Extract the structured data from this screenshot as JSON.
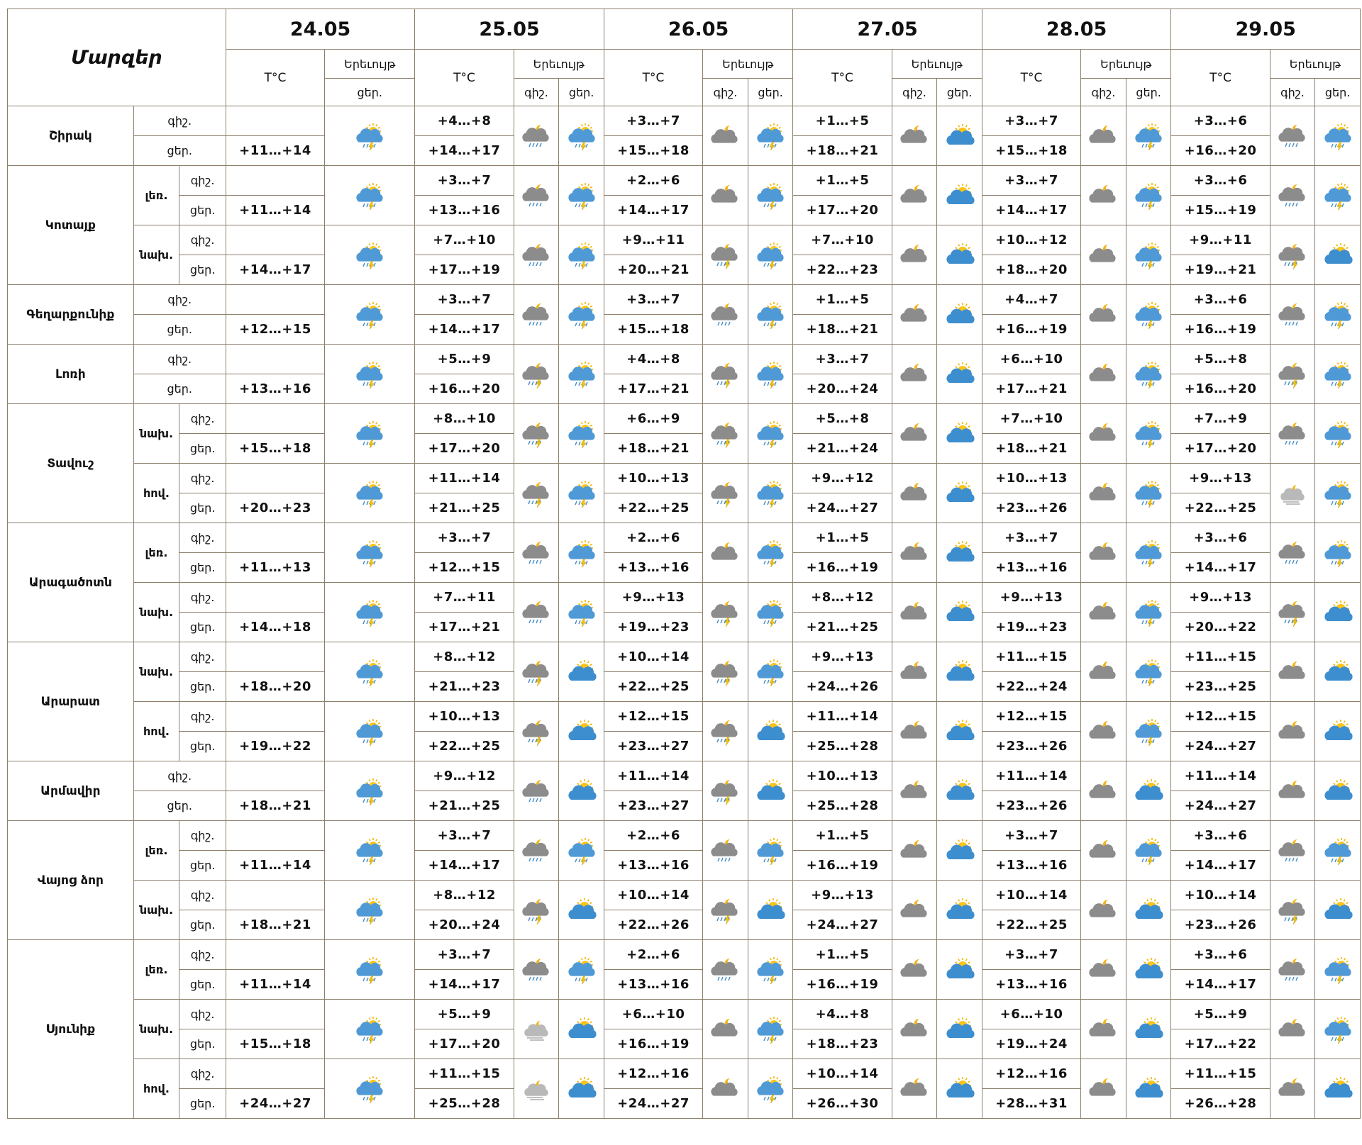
{
  "header": {
    "title": "Մարզեր",
    "dates": [
      "24.05",
      "25.05",
      "26.05",
      "27.05",
      "28.05",
      "29.05"
    ],
    "temp_label": "T°C",
    "phenomenon_label": "Երեւույթ",
    "night_label": "գիշ.",
    "day_label": "ցեր."
  },
  "regions": [
    {
      "name": "Շիրակ",
      "zones": [
        {
          "zone": "",
          "night": [
            "",
            "+4…+8",
            "+3…+7",
            "+1…+5",
            "+3…+7",
            "+3…+6"
          ],
          "day": [
            "+11…+14",
            "+14…+17",
            "+15…+18",
            "+18…+21",
            "+15…+18",
            "+16…+20"
          ],
          "icons_night": [
            "",
            "cloud-moon-rain",
            "cloud-moon",
            "cloud-moon",
            "cloud-moon",
            "cloud-moon-rain"
          ],
          "icons_day": [
            "sun-cloud-rain",
            "sun-cloud-rain",
            "sun-cloud-rain",
            "sun-cloud",
            "sun-cloud-rain",
            "sun-cloud-rain"
          ]
        }
      ]
    },
    {
      "name": "Կոտայք",
      "zones": [
        {
          "zone": "լեռ.",
          "night": [
            "",
            "+3…+7",
            "+2…+6",
            "+1…+5",
            "+3…+7",
            "+3…+6"
          ],
          "day": [
            "+11…+14",
            "+13…+16",
            "+14…+17",
            "+17…+20",
            "+14…+17",
            "+15…+19"
          ],
          "icons_night": [
            "",
            "cloud-moon-rain",
            "cloud-moon",
            "cloud-moon",
            "cloud-moon",
            "cloud-moon-rain"
          ],
          "icons_day": [
            "sun-cloud-rain",
            "sun-cloud-rain",
            "sun-cloud-rain",
            "sun-cloud",
            "sun-cloud-rain",
            "sun-cloud-rain"
          ]
        },
        {
          "zone": "նախ.",
          "night": [
            "",
            "+7…+10",
            "+9…+11",
            "+7…+10",
            "+10…+12",
            "+9…+11"
          ],
          "day": [
            "+14…+17",
            "+17…+19",
            "+20…+21",
            "+22…+23",
            "+18…+20",
            "+19…+21"
          ],
          "icons_night": [
            "",
            "cloud-moon-rain",
            "cloud-moon-storm",
            "cloud-moon",
            "cloud-moon",
            "cloud-moon-storm"
          ],
          "icons_day": [
            "sun-cloud-rain",
            "sun-cloud-rain",
            "sun-cloud-rain",
            "sun-cloud",
            "sun-cloud-rain",
            "sun-cloud"
          ]
        }
      ]
    },
    {
      "name": "Գեղարքունիք",
      "zones": [
        {
          "zone": "",
          "night": [
            "",
            "+3…+7",
            "+3…+7",
            "+1…+5",
            "+4…+7",
            "+3…+6"
          ],
          "day": [
            "+12…+15",
            "+14…+17",
            "+15…+18",
            "+18…+21",
            "+16…+19",
            "+16…+19"
          ],
          "icons_night": [
            "",
            "cloud-moon-rain",
            "cloud-moon-rain",
            "cloud-moon",
            "cloud-moon",
            "cloud-moon-rain"
          ],
          "icons_day": [
            "sun-cloud-rain",
            "sun-cloud-rain",
            "sun-cloud-rain",
            "sun-cloud",
            "sun-cloud-rain",
            "sun-cloud-rain"
          ]
        }
      ]
    },
    {
      "name": "Լոռի",
      "zones": [
        {
          "zone": "",
          "night": [
            "",
            "+5…+9",
            "+4…+8",
            "+3…+7",
            "+6…+10",
            "+5…+8"
          ],
          "day": [
            "+13…+16",
            "+16…+20",
            "+17…+21",
            "+20…+24",
            "+17…+21",
            "+16…+20"
          ],
          "icons_night": [
            "",
            "cloud-moon-storm",
            "cloud-moon-storm",
            "cloud-moon",
            "cloud-moon",
            "cloud-moon-storm"
          ],
          "icons_day": [
            "sun-cloud-rain",
            "sun-cloud-rain",
            "sun-cloud-rain",
            "sun-cloud",
            "sun-cloud-rain",
            "sun-cloud-rain"
          ]
        }
      ]
    },
    {
      "name": "Տավուշ",
      "zones": [
        {
          "zone": "նախ.",
          "night": [
            "",
            "+8…+10",
            "+6…+9",
            "+5…+8",
            "+7…+10",
            "+7…+9"
          ],
          "day": [
            "+15…+18",
            "+17…+20",
            "+18…+21",
            "+21…+24",
            "+18…+21",
            "+17…+20"
          ],
          "icons_night": [
            "",
            "cloud-moon-storm",
            "cloud-moon-storm",
            "cloud-moon",
            "cloud-moon",
            "cloud-moon-rain"
          ],
          "icons_day": [
            "sun-cloud-rain",
            "sun-cloud-rain",
            "sun-cloud-rain",
            "sun-cloud",
            "sun-cloud-rain",
            "sun-cloud-rain"
          ]
        },
        {
          "zone": "հով.",
          "night": [
            "",
            "+11…+14",
            "+10…+13",
            "+9…+12",
            "+10…+13",
            "+9…+13"
          ],
          "day": [
            "+20…+23",
            "+21…+25",
            "+22…+25",
            "+24…+27",
            "+23…+26",
            "+22…+25"
          ],
          "icons_night": [
            "",
            "cloud-moon-storm",
            "cloud-moon-storm",
            "cloud-moon",
            "cloud-moon",
            "cloud-fog"
          ],
          "icons_day": [
            "sun-cloud-rain",
            "sun-cloud-rain",
            "sun-cloud-rain",
            "sun-cloud",
            "sun-cloud-rain",
            "sun-cloud-rain"
          ]
        }
      ]
    },
    {
      "name": "Արագածոտն",
      "zones": [
        {
          "zone": "լեռ.",
          "night": [
            "",
            "+3…+7",
            "+2…+6",
            "+1…+5",
            "+3…+7",
            "+3…+6"
          ],
          "day": [
            "+11…+13",
            "+12…+15",
            "+13…+16",
            "+16…+19",
            "+13…+16",
            "+14…+17"
          ],
          "icons_night": [
            "",
            "cloud-moon-rain",
            "cloud-moon",
            "cloud-moon",
            "cloud-moon",
            "cloud-moon-rain"
          ],
          "icons_day": [
            "sun-cloud-rain",
            "sun-cloud-rain",
            "sun-cloud-rain",
            "sun-cloud",
            "sun-cloud-rain",
            "sun-cloud-rain"
          ]
        },
        {
          "zone": "նախ.",
          "night": [
            "",
            "+7…+11",
            "+9…+13",
            "+8…+12",
            "+9…+13",
            "+9…+13"
          ],
          "day": [
            "+14…+18",
            "+17…+21",
            "+19…+23",
            "+21…+25",
            "+19…+23",
            "+20…+22"
          ],
          "icons_night": [
            "",
            "cloud-moon-rain",
            "cloud-moon-storm",
            "cloud-moon",
            "cloud-moon",
            "cloud-moon-storm"
          ],
          "icons_day": [
            "sun-cloud-rain",
            "sun-cloud-rain",
            "sun-cloud-rain",
            "sun-cloud",
            "sun-cloud-rain",
            "sun-cloud"
          ]
        }
      ]
    },
    {
      "name": "Արարատ",
      "zones": [
        {
          "zone": "նախ.",
          "night": [
            "",
            "+8…+12",
            "+10…+14",
            "+9…+13",
            "+11…+15",
            "+11…+15"
          ],
          "day": [
            "+18…+20",
            "+21…+23",
            "+22…+25",
            "+24…+26",
            "+22…+24",
            "+23…+25"
          ],
          "icons_night": [
            "",
            "cloud-moon-storm",
            "cloud-moon-storm",
            "cloud-moon",
            "cloud-moon",
            "cloud-moon"
          ],
          "icons_day": [
            "sun-cloud-rain",
            "sun-cloud",
            "sun-cloud-rain",
            "sun-cloud",
            "sun-cloud-rain",
            "sun-cloud"
          ]
        },
        {
          "zone": "հով.",
          "night": [
            "",
            "+10…+13",
            "+12…+15",
            "+11…+14",
            "+12…+15",
            "+12…+15"
          ],
          "day": [
            "+19…+22",
            "+22…+25",
            "+23…+27",
            "+25…+28",
            "+23…+26",
            "+24…+27"
          ],
          "icons_night": [
            "",
            "cloud-moon-storm",
            "cloud-moon-storm",
            "cloud-moon",
            "cloud-moon",
            "cloud-moon"
          ],
          "icons_day": [
            "sun-cloud-rain",
            "sun-cloud",
            "sun-cloud",
            "sun-cloud",
            "sun-cloud-rain",
            "sun-cloud"
          ]
        }
      ]
    },
    {
      "name": "Արմավիր",
      "zones": [
        {
          "zone": "",
          "night": [
            "",
            "+9…+12",
            "+11…+14",
            "+10…+13",
            "+11…+14",
            "+11…+14"
          ],
          "day": [
            "+18…+21",
            "+21…+25",
            "+23…+27",
            "+25…+28",
            "+23…+26",
            "+24…+27"
          ],
          "icons_night": [
            "",
            "cloud-moon-rain",
            "cloud-moon-storm",
            "cloud-moon",
            "cloud-moon",
            "cloud-moon"
          ],
          "icons_day": [
            "sun-cloud-rain",
            "sun-cloud",
            "sun-cloud",
            "sun-cloud",
            "sun-cloud",
            "sun-cloud"
          ]
        }
      ]
    },
    {
      "name": "Վայոց ձոր",
      "zones": [
        {
          "zone": "լեռ.",
          "night": [
            "",
            "+3…+7",
            "+2…+6",
            "+1…+5",
            "+3…+7",
            "+3…+6"
          ],
          "day": [
            "+11…+14",
            "+14…+17",
            "+13…+16",
            "+16…+19",
            "+13…+16",
            "+14…+17"
          ],
          "icons_night": [
            "",
            "cloud-moon-rain",
            "cloud-moon-rain",
            "cloud-moon",
            "cloud-moon",
            "cloud-moon-rain"
          ],
          "icons_day": [
            "sun-cloud-rain",
            "sun-cloud-rain",
            "sun-cloud-rain",
            "sun-cloud",
            "sun-cloud-rain",
            "sun-cloud-rain"
          ]
        },
        {
          "zone": "նախ.",
          "night": [
            "",
            "+8…+12",
            "+10…+14",
            "+9…+13",
            "+10…+14",
            "+10…+14"
          ],
          "day": [
            "+18…+21",
            "+20…+24",
            "+22…+26",
            "+24…+27",
            "+22…+25",
            "+23…+26"
          ],
          "icons_night": [
            "",
            "cloud-moon-storm",
            "cloud-moon-storm",
            "cloud-moon",
            "cloud-moon",
            "cloud-moon-storm"
          ],
          "icons_day": [
            "sun-cloud-rain",
            "sun-cloud",
            "sun-cloud",
            "sun-cloud",
            "sun-cloud",
            "sun-cloud"
          ]
        }
      ]
    },
    {
      "name": "Սյունիք",
      "zones": [
        {
          "zone": "լեռ.",
          "night": [
            "",
            "+3…+7",
            "+2…+6",
            "+1…+5",
            "+3…+7",
            "+3…+6"
          ],
          "day": [
            "+11…+14",
            "+14…+17",
            "+13…+16",
            "+16…+19",
            "+13…+16",
            "+14…+17"
          ],
          "icons_night": [
            "",
            "cloud-moon-rain",
            "cloud-moon-rain",
            "cloud-moon",
            "cloud-moon",
            "cloud-moon-rain"
          ],
          "icons_day": [
            "sun-cloud-rain",
            "sun-cloud-rain",
            "sun-cloud-rain",
            "sun-cloud",
            "sun-cloud",
            "sun-cloud-rain"
          ]
        },
        {
          "zone": "նախ.",
          "night": [
            "",
            "+5…+9",
            "+6…+10",
            "+4…+8",
            "+6…+10",
            "+5…+9"
          ],
          "day": [
            "+15…+18",
            "+17…+20",
            "+16…+19",
            "+18…+23",
            "+19…+24",
            "+17…+22"
          ],
          "icons_night": [
            "",
            "cloud-fog",
            "cloud-moon",
            "cloud-moon",
            "cloud-moon",
            "cloud-moon"
          ],
          "icons_day": [
            "sun-cloud-rain",
            "sun-cloud",
            "sun-cloud-rain",
            "sun-cloud",
            "sun-cloud",
            "sun-cloud-rain"
          ]
        },
        {
          "zone": "հով.",
          "night": [
            "",
            "+11…+15",
            "+12…+16",
            "+10…+14",
            "+12…+16",
            "+11…+15"
          ],
          "day": [
            "+24…+27",
            "+25…+28",
            "+24…+27",
            "+26…+30",
            "+28…+31",
            "+26…+28"
          ],
          "icons_night": [
            "",
            "cloud-fog",
            "cloud-moon",
            "cloud-moon",
            "cloud-moon",
            "cloud-moon"
          ],
          "icons_day": [
            "sun-cloud-rain",
            "sun-cloud",
            "sun-cloud-rain",
            "sun-cloud",
            "sun-cloud",
            "sun-cloud"
          ]
        }
      ]
    }
  ]
}
